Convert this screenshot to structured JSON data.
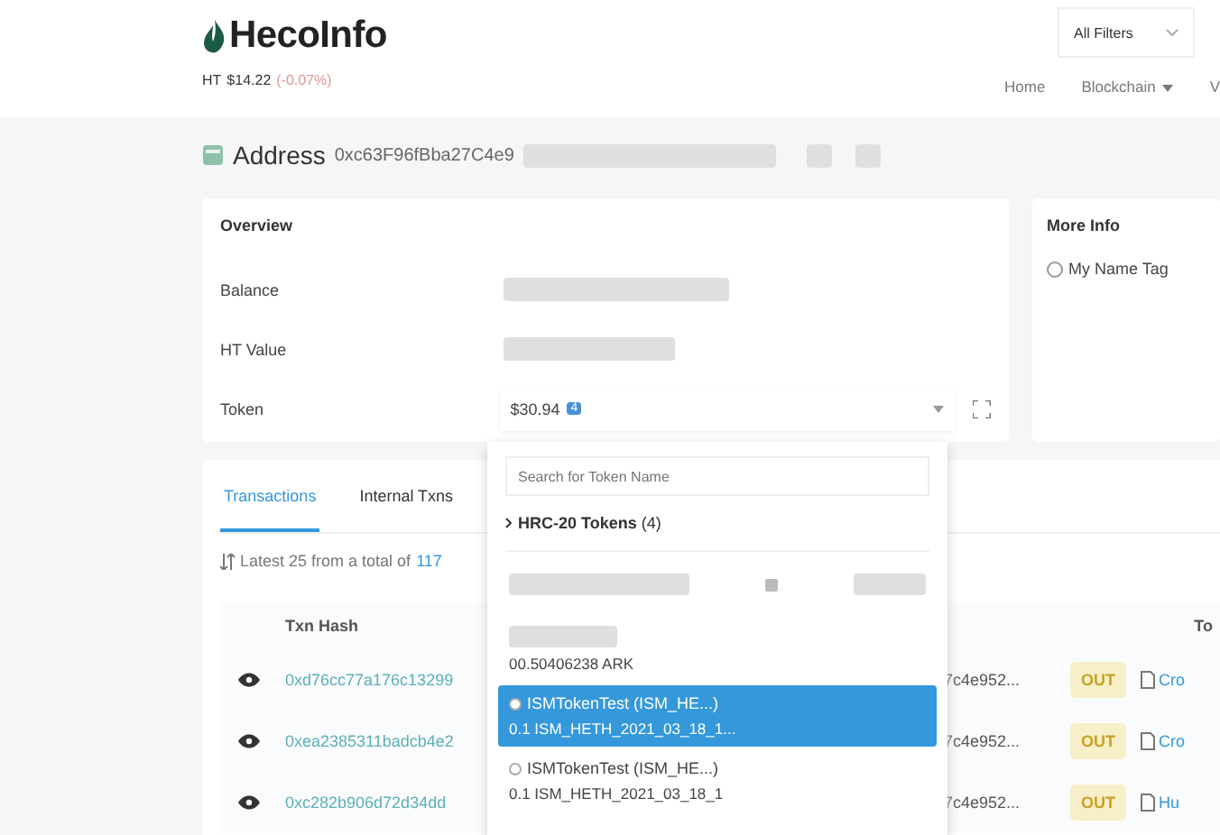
{
  "header": {
    "logo": "HecoInfo",
    "price_label": "HT",
    "price": "$14.22",
    "change": "(-0.07%)",
    "filter": "All Filters",
    "nav": [
      {
        "label": "Home",
        "dropdown": false
      },
      {
        "label": "Blockchain",
        "dropdown": true
      },
      {
        "label": "V",
        "dropdown": false
      }
    ]
  },
  "address": {
    "label": "Address",
    "value": "0xc63F96fBba27C4e9"
  },
  "overview": {
    "title": "Overview",
    "rows": [
      {
        "label": "Balance",
        "kind": "redacted"
      },
      {
        "label": "HT Value",
        "kind": "redacted"
      },
      {
        "label": "Token",
        "kind": "token",
        "value": "$30.94",
        "badge": "4"
      }
    ]
  },
  "more_info": {
    "title": "More Info",
    "items": [
      "My Name Tag"
    ]
  },
  "token_dropdown": {
    "placeholder": "Search for Token Name",
    "group": "HRC-20 Tokens",
    "group_count": "(4)",
    "items": [
      {
        "kind": "redacted",
        "selected": false
      },
      {
        "kind": "amount_only",
        "amount": "00.50406238 ARK",
        "selected": false
      },
      {
        "kind": "full",
        "name": "ISMTokenTest (ISM_HE...)",
        "amount": "0.1 ISM_HETH_2021_03_18_1...",
        "selected": true
      },
      {
        "kind": "full",
        "name": "ISMTokenTest (ISM_HE...)",
        "amount": "0.1 ISM_HETH_2021_03_18_1",
        "selected": false
      }
    ]
  },
  "tabs": [
    {
      "label": "Transactions",
      "selected": true
    },
    {
      "label": "Internal Txns",
      "selected": false
    }
  ],
  "summary": {
    "text": "Latest 25 from a total of",
    "count": "117"
  },
  "table": {
    "columns": [
      "Txn Hash",
      "To"
    ],
    "rows": [
      {
        "hash": "0xd76cc77a176c13299",
        "from": "7c4e952...",
        "direction": "OUT",
        "to": "Cro"
      },
      {
        "hash": "0xea2385311badcb4e2",
        "from": "7c4e952...",
        "direction": "OUT",
        "to": "Cro"
      },
      {
        "hash": "0xc282b906d72d34dd",
        "from": "7c4e952...",
        "direction": "OUT",
        "to": "Hu"
      }
    ]
  }
}
